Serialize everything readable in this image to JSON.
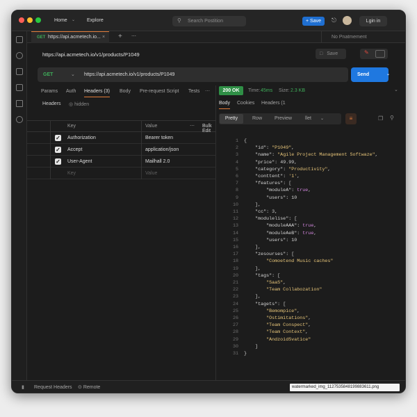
{
  "titlebar": {
    "home": "Home",
    "explore": "Explore",
    "search_placeholder": "Search Postition",
    "save": "Save",
    "login": "Lgin in"
  },
  "tab": {
    "method": "GET",
    "url": "https://api.acmetech.io...",
    "environment": "No Pnatmement"
  },
  "request": {
    "title": "https://api.acmetech.io/v1/products/P1049",
    "save_label": "Save",
    "method": "GET",
    "url": "https://api.acmetech.io/v1/products/P1049",
    "send": "Send"
  },
  "req_tabs": [
    "Params",
    "Auth",
    "Headers (3)",
    "Body",
    "Pre-request Script",
    "Tests"
  ],
  "headers_sub": {
    "label": "Headers",
    "hidden": "hidden"
  },
  "table": {
    "col_key": "Key",
    "col_value": "Value",
    "bulk": "Bulk Edit",
    "rows": [
      {
        "key": "Authorization",
        "value": "Bearer token",
        "checked": true
      },
      {
        "key": "Accept",
        "value": "application/json",
        "checked": true
      },
      {
        "key": "User-Agent",
        "value": "Mailhall 2.0",
        "checked": true
      }
    ],
    "placeholder_key": "Key",
    "placeholder_value": "Value"
  },
  "response": {
    "status": "200 OK",
    "time_label": "Time:",
    "time_value": "45ms",
    "size_label": "Size:",
    "size_value": "2.3 KB",
    "tabs": [
      "Body",
      "Cookies",
      "Headers (1"
    ],
    "view_tabs": [
      "Pretty",
      "Row",
      "Preview"
    ],
    "format": "llet"
  },
  "code_lines": [
    [
      {
        "t": "{",
        "c": "p"
      }
    ],
    [
      {
        "t": "    \"id\"",
        "c": "k"
      },
      {
        "t": ": ",
        "c": "p"
      },
      {
        "t": "\"P1049\"",
        "c": "s"
      },
      {
        "t": ",",
        "c": "p"
      }
    ],
    [
      {
        "t": "    \"name\"",
        "c": "k"
      },
      {
        "t": ": ",
        "c": "p"
      },
      {
        "t": "\"Agile Project Management Softwaze\"",
        "c": "s"
      },
      {
        "t": ",",
        "c": "p"
      }
    ],
    [
      {
        "t": "    \"price\"",
        "c": "k"
      },
      {
        "t": ": ",
        "c": "p"
      },
      {
        "t": "49.99",
        "c": "n"
      },
      {
        "t": ",",
        "c": "p"
      }
    ],
    [
      {
        "t": "    \"category\"",
        "c": "k"
      },
      {
        "t": ": ",
        "c": "p"
      },
      {
        "t": "\"Productivity\"",
        "c": "s"
      },
      {
        "t": ",",
        "c": "p"
      }
    ],
    [
      {
        "t": "    \"conttent\"",
        "c": "k"
      },
      {
        "t": ": ",
        "c": "p"
      },
      {
        "t": "'1'",
        "c": "s"
      },
      {
        "t": ",",
        "c": "p"
      }
    ],
    [
      {
        "t": "    \"features\"",
        "c": "k"
      },
      {
        "t": ": [",
        "c": "p"
      }
    ],
    [
      {
        "t": "        \"moduleA\"",
        "c": "k"
      },
      {
        "t": ": ",
        "c": "p"
      },
      {
        "t": "true",
        "c": "b"
      },
      {
        "t": ",",
        "c": "p"
      }
    ],
    [
      {
        "t": "        \"users\"",
        "c": "k"
      },
      {
        "t": ": ",
        "c": "p"
      },
      {
        "t": "10",
        "c": "n"
      }
    ],
    [
      {
        "t": "    ],",
        "c": "p"
      }
    ],
    [
      {
        "t": "    \"cc\"",
        "c": "k"
      },
      {
        "t": ": ",
        "c": "p"
      },
      {
        "t": "3",
        "c": "n"
      },
      {
        "t": ",",
        "c": "p"
      }
    ],
    [
      {
        "t": "    \"modulelise\"",
        "c": "k"
      },
      {
        "t": ": [",
        "c": "p"
      }
    ],
    [
      {
        "t": "        \"moduleAAA\"",
        "c": "k"
      },
      {
        "t": ": ",
        "c": "p"
      },
      {
        "t": "true",
        "c": "b"
      },
      {
        "t": ",",
        "c": "p"
      }
    ],
    [
      {
        "t": "        \"moduleAeB\"",
        "c": "k"
      },
      {
        "t": ": ",
        "c": "p"
      },
      {
        "t": "true",
        "c": "b"
      },
      {
        "t": ",",
        "c": "p"
      }
    ],
    [
      {
        "t": "        \"users\"",
        "c": "k"
      },
      {
        "t": ": ",
        "c": "p"
      },
      {
        "t": "10",
        "c": "n"
      }
    ],
    [
      {
        "t": "    ],",
        "c": "p"
      }
    ],
    [
      {
        "t": "    \"zesourses\"",
        "c": "k"
      },
      {
        "t": ": [",
        "c": "p"
      }
    ],
    [
      {
        "t": "        \"Comoetend Music caches\"",
        "c": "s"
      }
    ],
    [
      {
        "t": "    ],",
        "c": "p"
      }
    ],
    [
      {
        "t": "    \"tags\"",
        "c": "k"
      },
      {
        "t": ": [",
        "c": "p"
      }
    ],
    [
      {
        "t": "        \"SaaS\"",
        "c": "s"
      },
      {
        "t": ",",
        "c": "p"
      }
    ],
    [
      {
        "t": "        \"Team Collabozation\"",
        "c": "s"
      }
    ],
    [
      {
        "t": "    ],",
        "c": "p"
      }
    ],
    [
      {
        "t": "    \"tagets\"",
        "c": "k"
      },
      {
        "t": ": [",
        "c": "p"
      }
    ],
    [
      {
        "t": "        \"Bemompice\"",
        "c": "s"
      },
      {
        "t": ",",
        "c": "p"
      }
    ],
    [
      {
        "t": "        \"Ostimitations\"",
        "c": "s"
      },
      {
        "t": ",",
        "c": "p"
      }
    ],
    [
      {
        "t": "        \"Team Conspect\"",
        "c": "s"
      },
      {
        "t": ",",
        "c": "p"
      }
    ],
    [
      {
        "t": "        \"Team Context\"",
        "c": "s"
      },
      {
        "t": ",",
        "c": "p"
      }
    ],
    [
      {
        "t": "        \"AndzoidSvatice\"",
        "c": "s"
      }
    ],
    [
      {
        "t": "    ]",
        "c": "p"
      }
    ],
    [
      {
        "t": "}",
        "c": "p"
      }
    ]
  ],
  "footer": {
    "request_headers": "Request Headers",
    "remote": "Remote",
    "watermark": "watermarked_img_1127535848199883611.png"
  },
  "colors": {
    "accent": "#e07b39",
    "primary": "#1f78e0",
    "status_ok": "#2f8f46"
  }
}
